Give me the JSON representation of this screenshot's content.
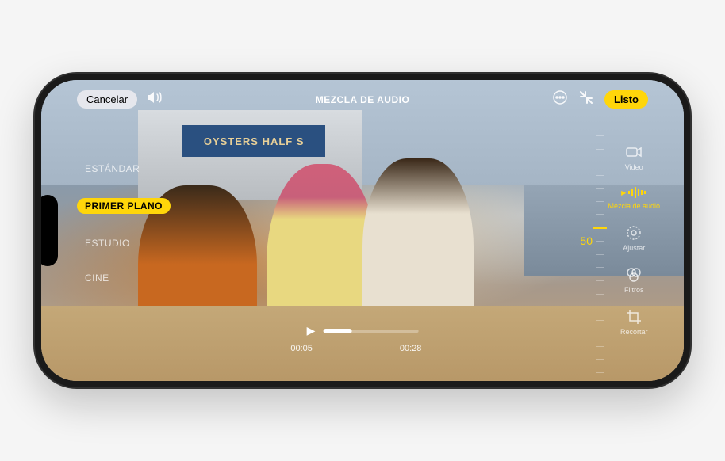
{
  "header": {
    "cancel_label": "Cancelar",
    "title": "MEZCLA DE AUDIO",
    "done_label": "Listo"
  },
  "background": {
    "sign_text": "OYSTERS HALF S"
  },
  "modes": [
    {
      "label": "ESTÁNDAR",
      "active": false
    },
    {
      "label": "PRIMER PLANO",
      "active": true
    },
    {
      "label": "ESTUDIO",
      "active": false
    },
    {
      "label": "CINE",
      "active": false
    }
  ],
  "tools": [
    {
      "label": "Video",
      "icon": "video",
      "active": false
    },
    {
      "label": "Mezcla de audio",
      "icon": "audio-mix",
      "active": true
    },
    {
      "label": "Ajustar",
      "icon": "adjust",
      "active": false
    },
    {
      "label": "Filtros",
      "icon": "filters",
      "active": false
    },
    {
      "label": "Recortar",
      "icon": "crop",
      "active": false
    }
  ],
  "dial": {
    "value": "50"
  },
  "playback": {
    "current_time": "00:05",
    "total_time": "00:28"
  }
}
